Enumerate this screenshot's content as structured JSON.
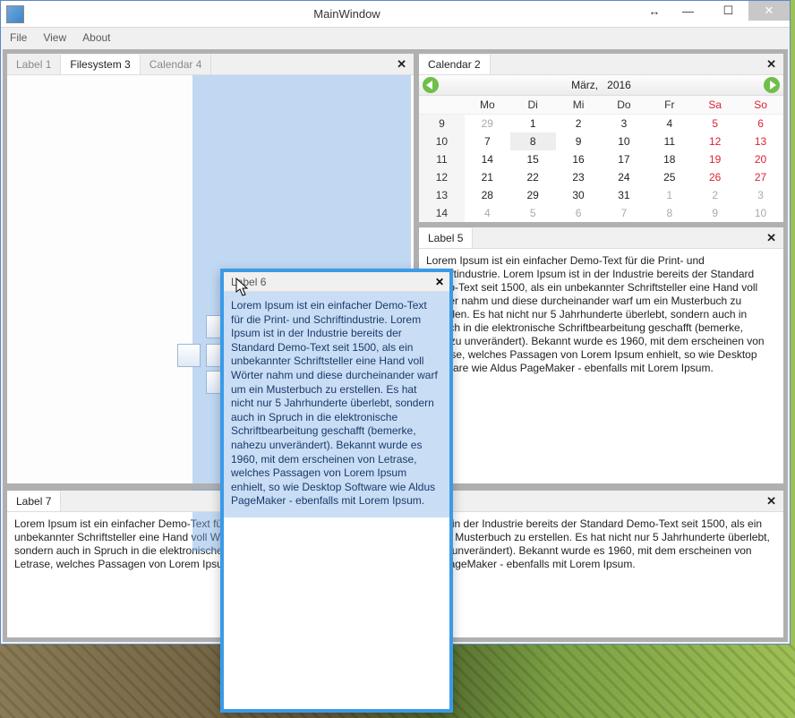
{
  "window": {
    "title": "MainWindow"
  },
  "menu": {
    "file": "File",
    "view": "View",
    "about": "About"
  },
  "left_pane": {
    "tabs": [
      {
        "label": "Label 1"
      },
      {
        "label": "Filesystem 3"
      },
      {
        "label": "Calendar 4"
      }
    ]
  },
  "calendar_pane": {
    "tab": "Calendar 2",
    "month": "März,",
    "year": "2016",
    "dow": [
      "Mo",
      "Di",
      "Mi",
      "Do",
      "Fr",
      "Sa",
      "So"
    ],
    "weeks": [
      {
        "wk": "9",
        "days": [
          {
            "d": "29",
            "o": true
          },
          {
            "d": "1"
          },
          {
            "d": "2"
          },
          {
            "d": "3"
          },
          {
            "d": "4"
          },
          {
            "d": "5",
            "w": true
          },
          {
            "d": "6",
            "w": true
          }
        ]
      },
      {
        "wk": "10",
        "days": [
          {
            "d": "7"
          },
          {
            "d": "8",
            "t": true
          },
          {
            "d": "9"
          },
          {
            "d": "10"
          },
          {
            "d": "11"
          },
          {
            "d": "12",
            "w": true
          },
          {
            "d": "13",
            "w": true
          }
        ]
      },
      {
        "wk": "11",
        "days": [
          {
            "d": "14"
          },
          {
            "d": "15"
          },
          {
            "d": "16"
          },
          {
            "d": "17"
          },
          {
            "d": "18"
          },
          {
            "d": "19",
            "w": true
          },
          {
            "d": "20",
            "w": true
          }
        ]
      },
      {
        "wk": "12",
        "days": [
          {
            "d": "21"
          },
          {
            "d": "22"
          },
          {
            "d": "23"
          },
          {
            "d": "24"
          },
          {
            "d": "25"
          },
          {
            "d": "26",
            "w": true
          },
          {
            "d": "27",
            "w": true
          }
        ]
      },
      {
        "wk": "13",
        "days": [
          {
            "d": "28"
          },
          {
            "d": "29"
          },
          {
            "d": "30"
          },
          {
            "d": "31"
          },
          {
            "d": "1",
            "o": true
          },
          {
            "d": "2",
            "o": true
          },
          {
            "d": "3",
            "o": true
          }
        ]
      },
      {
        "wk": "14",
        "days": [
          {
            "d": "4",
            "o": true
          },
          {
            "d": "5",
            "o": true
          },
          {
            "d": "6",
            "o": true
          },
          {
            "d": "7",
            "o": true
          },
          {
            "d": "8",
            "o": true
          },
          {
            "d": "9",
            "o": true
          },
          {
            "d": "10",
            "o": true
          }
        ]
      }
    ]
  },
  "label5": {
    "tab": "Label 5",
    "text": "Lorem Ipsum ist ein einfacher Demo-Text für die Print- und Schriftindustrie. Lorem Ipsum ist in der Industrie bereits der Standard Demo-Text seit 1500, als ein unbekannter Schriftsteller eine Hand voll Wörter nahm und diese durcheinander warf um ein Musterbuch zu erstellen. Es hat nicht nur 5 Jahrhunderte überlebt, sondern auch in Spruch in die elektronische Schriftbearbeitung geschafft (bemerke, nahezu unverändert). Bekannt wurde es 1960, mit dem erscheinen von Letrase, welches Passagen von Lorem Ipsum enhielt, so wie Desktop Software wie Aldus PageMaker - ebenfalls mit Lorem Ipsum."
  },
  "label7": {
    "tab": "Label 7",
    "text": "Lorem Ipsum ist ein einfacher Demo-Text für die Print- und Schriftindustrie. Lorem Ipsum ist in der Industrie bereits der Standard Demo-Text seit 1500, als ein unbekannter Schriftsteller eine Hand voll Wörter nahm und diese durcheinander warf um ein Musterbuch zu erstellen. Es hat nicht nur 5 Jahrhunderte überlebt, sondern auch in Spruch in die elektronische Schriftbearbeitung geschafft (bemerke, nahezu unverändert). Bekannt wurde es 1960, mit dem erscheinen von Letrase, welches Passagen von Lorem Ipsum enhielt, so wie Desktop Software wie Aldus PageMaker - ebenfalls mit Lorem Ipsum."
  },
  "float": {
    "title": "Label 6",
    "text": "Lorem Ipsum ist ein einfacher Demo-Text für die Print- und Schriftindustrie. Lorem Ipsum ist in der Industrie bereits der Standard Demo-Text seit 1500, als ein unbekannter Schriftsteller eine Hand voll Wörter nahm und diese durcheinander warf um ein Musterbuch zu erstellen. Es hat nicht nur 5 Jahrhunderte überlebt, sondern auch in Spruch in die elektronische Schriftbearbeitung geschafft (bemerke, nahezu unverändert). Bekannt wurde es 1960, mit dem erscheinen von Letrase, welches Passagen von Lorem Ipsum enhielt, so wie Desktop Software wie Aldus PageMaker - ebenfalls mit Lorem Ipsum."
  }
}
